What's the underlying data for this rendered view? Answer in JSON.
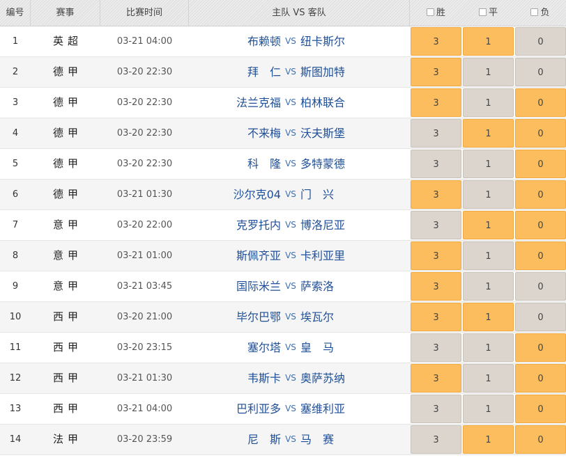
{
  "header": {
    "num": "编号",
    "event": "赛事",
    "time": "比赛时间",
    "teams": "主队 VS 客队",
    "win": "胜",
    "draw": "平",
    "lose": "负"
  },
  "colors": {
    "selected": "#fbbd5e",
    "unselected": "#dcd5cd",
    "team_text": "#1f4f96"
  },
  "rows": [
    {
      "num": "1",
      "event": "英超",
      "time": "03-21 04:00",
      "home": "布赖顿",
      "vs": "VS",
      "away": "纽卡斯尔",
      "odds": [
        "3",
        "1",
        "0"
      ],
      "selected": [
        true,
        true,
        false
      ]
    },
    {
      "num": "2",
      "event": "德甲",
      "time": "03-20 22:30",
      "home": "拜　仁",
      "vs": "VS",
      "away": "斯图加特",
      "odds": [
        "3",
        "1",
        "0"
      ],
      "selected": [
        true,
        false,
        false
      ]
    },
    {
      "num": "3",
      "event": "德甲",
      "time": "03-20 22:30",
      "home": "法兰克福",
      "vs": "VS",
      "away": "柏林联合",
      "odds": [
        "3",
        "1",
        "0"
      ],
      "selected": [
        true,
        false,
        true
      ]
    },
    {
      "num": "4",
      "event": "德甲",
      "time": "03-20 22:30",
      "home": "不来梅",
      "vs": "VS",
      "away": "沃夫斯堡",
      "odds": [
        "3",
        "1",
        "0"
      ],
      "selected": [
        false,
        true,
        true
      ]
    },
    {
      "num": "5",
      "event": "德甲",
      "time": "03-20 22:30",
      "home": "科　隆",
      "vs": "VS",
      "away": "多特蒙德",
      "odds": [
        "3",
        "1",
        "0"
      ],
      "selected": [
        false,
        false,
        true
      ]
    },
    {
      "num": "6",
      "event": "德甲",
      "time": "03-21 01:30",
      "home": "沙尔克04",
      "vs": "VS",
      "away": "门　兴",
      "odds": [
        "3",
        "1",
        "0"
      ],
      "selected": [
        true,
        false,
        true
      ]
    },
    {
      "num": "7",
      "event": "意甲",
      "time": "03-20 22:00",
      "home": "克罗托内",
      "vs": "VS",
      "away": "博洛尼亚",
      "odds": [
        "3",
        "1",
        "0"
      ],
      "selected": [
        false,
        true,
        true
      ]
    },
    {
      "num": "8",
      "event": "意甲",
      "time": "03-21 01:00",
      "home": "斯佩齐亚",
      "vs": "VS",
      "away": "卡利亚里",
      "odds": [
        "3",
        "1",
        "0"
      ],
      "selected": [
        true,
        false,
        true
      ]
    },
    {
      "num": "9",
      "event": "意甲",
      "time": "03-21 03:45",
      "home": "国际米兰",
      "vs": "VS",
      "away": "萨索洛",
      "odds": [
        "3",
        "1",
        "0"
      ],
      "selected": [
        true,
        false,
        false
      ]
    },
    {
      "num": "10",
      "event": "西甲",
      "time": "03-20 21:00",
      "home": "毕尔巴鄂",
      "vs": "VS",
      "away": "埃瓦尔",
      "odds": [
        "3",
        "1",
        "0"
      ],
      "selected": [
        true,
        true,
        false
      ]
    },
    {
      "num": "11",
      "event": "西甲",
      "time": "03-20 23:15",
      "home": "塞尔塔",
      "vs": "VS",
      "away": "皇　马",
      "odds": [
        "3",
        "1",
        "0"
      ],
      "selected": [
        false,
        false,
        true
      ]
    },
    {
      "num": "12",
      "event": "西甲",
      "time": "03-21 01:30",
      "home": "韦斯卡",
      "vs": "VS",
      "away": "奥萨苏纳",
      "odds": [
        "3",
        "1",
        "0"
      ],
      "selected": [
        true,
        false,
        true
      ]
    },
    {
      "num": "13",
      "event": "西甲",
      "time": "03-21 04:00",
      "home": "巴利亚多",
      "vs": "VS",
      "away": "塞维利亚",
      "odds": [
        "3",
        "1",
        "0"
      ],
      "selected": [
        false,
        false,
        true
      ]
    },
    {
      "num": "14",
      "event": "法甲",
      "time": "03-20 23:59",
      "home": "尼　斯",
      "vs": "VS",
      "away": "马　赛",
      "odds": [
        "3",
        "1",
        "0"
      ],
      "selected": [
        false,
        true,
        true
      ]
    }
  ]
}
